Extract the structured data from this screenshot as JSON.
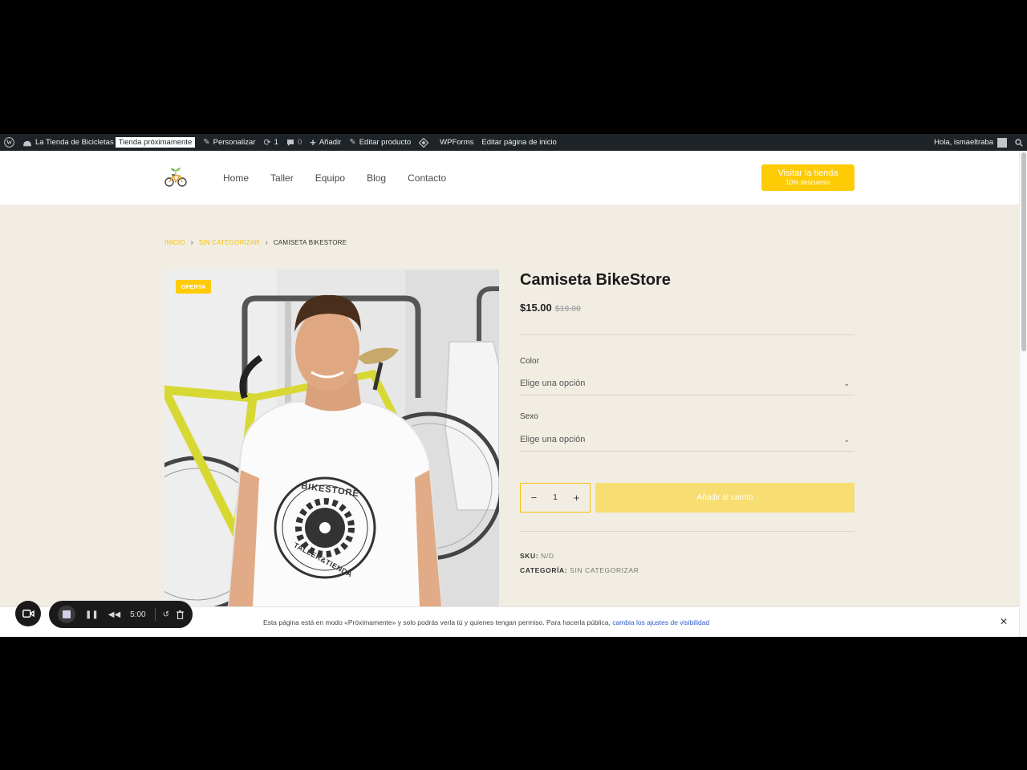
{
  "adminbar": {
    "site_name": "La Tienda de Bicicletas",
    "coming_soon_badge": "Tienda próximamente",
    "customize": "Personalizar",
    "updates_count": "1",
    "comments_count": "0",
    "add_new": "Añadir",
    "edit_product": "Editar producto",
    "wpforms": "WPForms",
    "edit_home": "Editar página de inicio",
    "greeting": "Hola, ismaeltraba"
  },
  "nav": {
    "items": [
      {
        "label": "Home"
      },
      {
        "label": "Taller"
      },
      {
        "label": "Equipo"
      },
      {
        "label": "Blog"
      },
      {
        "label": "Contacto"
      }
    ],
    "cta_label": "Visitar la tienda",
    "cta_sublabel": "10% descuento"
  },
  "breadcrumb": {
    "home": "INICIO",
    "category": "SIN CATEGORIZAR",
    "current": "CAMISETA BIKESTORE"
  },
  "product": {
    "sale_badge": "OFERTA",
    "title": "Camiseta BikeStore",
    "price": "$15.00",
    "regular_price": "$19.00",
    "shirt_text_top": "BIKESTORE",
    "shirt_text_bottom": "TALLER&TIENDA",
    "color_label": "Color",
    "color_placeholder": "Elige una opción",
    "sex_label": "Sexo",
    "sex_placeholder": "Elige una opción",
    "quantity": "1",
    "add_to_cart": "Añadir al carrito",
    "sku_label": "SKU:",
    "sku_value": "N/D",
    "category_label": "CATEGORÍA:",
    "category_value": "SIN CATEGORIZAR"
  },
  "notice": {
    "text": "Esta página está en modo «Próximamente» y solo podrás verla tú y quienes tengan permiso. Para hacerla pública,",
    "link": "cambia los ajustes de visibilidad",
    "close": "✕"
  },
  "recorder": {
    "time": "5:00"
  },
  "colors": {
    "accent": "#ffcb05",
    "page_bg": "#f1ede3",
    "adminbar_bg": "#1d2327"
  }
}
